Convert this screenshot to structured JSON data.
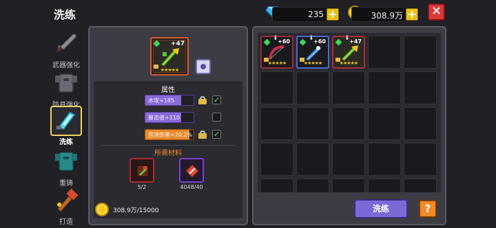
{
  "header": {
    "title": "洗练",
    "gems": "235",
    "gold": "308.9万",
    "plus": "+",
    "close": "✕"
  },
  "sidebar": {
    "items": [
      {
        "label": "武器强化",
        "icon": "sword-icon"
      },
      {
        "label": "防具强化",
        "icon": "armor-icon"
      },
      {
        "label": "洗练",
        "icon": "refine-crystal-icon",
        "active": true
      },
      {
        "label": "重铸",
        "icon": "reforge-armor-icon"
      },
      {
        "label": "打造",
        "icon": "forge-hammer-icon"
      }
    ]
  },
  "equipment": {
    "level": "+47",
    "stars": "★★★★★"
  },
  "attributes": {
    "title": "属性",
    "rows": [
      {
        "text": "木攻+185",
        "locked": true,
        "checked": true,
        "color": "#8a6ad8"
      },
      {
        "text": "暴击值+110",
        "locked": false,
        "checked": false,
        "color": "#8a6ad8"
      },
      {
        "text": "首领伤害+20.2%",
        "locked": true,
        "checked": true,
        "color": "#e88a2a"
      }
    ]
  },
  "materials": {
    "title": "所需材料",
    "items": [
      {
        "count": "5/2",
        "icon": "refine-stone-icon"
      },
      {
        "count": "4048/40",
        "icon": "crystal-shard-icon"
      }
    ]
  },
  "gold_cost": "308.9万/15000",
  "inventory": {
    "items": [
      {
        "level": "+60",
        "name": "crimson-bow-icon"
      },
      {
        "level": "+60",
        "name": "ice-sword-icon"
      },
      {
        "level": "+47",
        "name": "green-staff-icon"
      }
    ]
  },
  "action_button": "洗练",
  "help_button": "?",
  "colors": {
    "accent_purple": "#7a6ad8",
    "gold": "#f5c518",
    "close_red": "#d83a3a",
    "help_orange": "#f08a2a"
  }
}
